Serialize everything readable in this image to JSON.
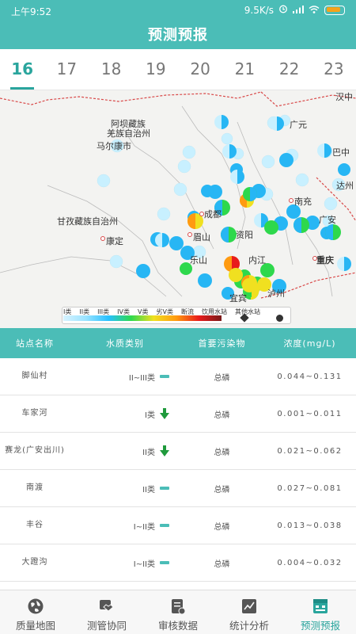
{
  "status": {
    "time": "上午9:52",
    "speed": "9.5K/s"
  },
  "page": {
    "title": "预测预报"
  },
  "date_tabs": [
    "16",
    "17",
    "18",
    "19",
    "20",
    "21",
    "22",
    "23"
  ],
  "active_tab": "16",
  "map": {
    "labels": {
      "aba": "阿坝藏族",
      "aba2": "羌族自治州",
      "maerkang": "马尔康市",
      "ganzi": "甘孜藏族自治州",
      "kangding": "康定",
      "chengdu": "成都",
      "meishan": "眉山",
      "leshan": "乐山",
      "ziyang": "资阳",
      "neijiang": "内江",
      "yibin": "宜宾",
      "luzhou": "泸州",
      "nanchong": "南充",
      "guangan": "广安",
      "chongqing": "重庆",
      "guangyuan": "广元",
      "bazhong": "巴中",
      "hanzhong": "汉中",
      "dazhou": "达州"
    },
    "legend": [
      "I类",
      "II类",
      "III类",
      "IV类",
      "V类",
      "劣V类",
      "断流",
      "饮用水站",
      "其他水站"
    ]
  },
  "table": {
    "headers": {
      "name": "站点名称",
      "category": "水质类别",
      "pollutant": "首要污染物",
      "concentration": "浓度(mg/L)"
    },
    "rows": [
      {
        "name": "脚仙村",
        "category": "II~III类",
        "trend": "flat",
        "pollutant": "总磷",
        "concentration": "0.044~0.131"
      },
      {
        "name": "车家河",
        "category": "I类",
        "trend": "down",
        "pollutant": "总磷",
        "concentration": "0.001~0.011"
      },
      {
        "name": "赛龙(广安出川)",
        "category": "II类",
        "trend": "down",
        "pollutant": "总磷",
        "concentration": "0.021~0.062"
      },
      {
        "name": "南渡",
        "category": "II类",
        "trend": "flat",
        "pollutant": "总磷",
        "concentration": "0.027~0.081"
      },
      {
        "name": "丰谷",
        "category": "I~II类",
        "trend": "flat",
        "pollutant": "总磷",
        "concentration": "0.013~0.038"
      },
      {
        "name": "大蹬沟",
        "category": "I~II类",
        "trend": "flat",
        "pollutant": "总磷",
        "concentration": "0.004~0.032"
      }
    ]
  },
  "bottom_nav": [
    {
      "label": "质量地图",
      "icon": "globe-icon"
    },
    {
      "label": "测管协同",
      "icon": "handshake-icon"
    },
    {
      "label": "审核数据",
      "icon": "clipboard-check-icon"
    },
    {
      "label": "统计分析",
      "icon": "line-chart-icon"
    },
    {
      "label": "预测预报",
      "icon": "forecast-icon"
    }
  ],
  "active_nav": "预测预报",
  "colors": {
    "accent": "#4bbdb7",
    "active": "#2aa59d"
  }
}
